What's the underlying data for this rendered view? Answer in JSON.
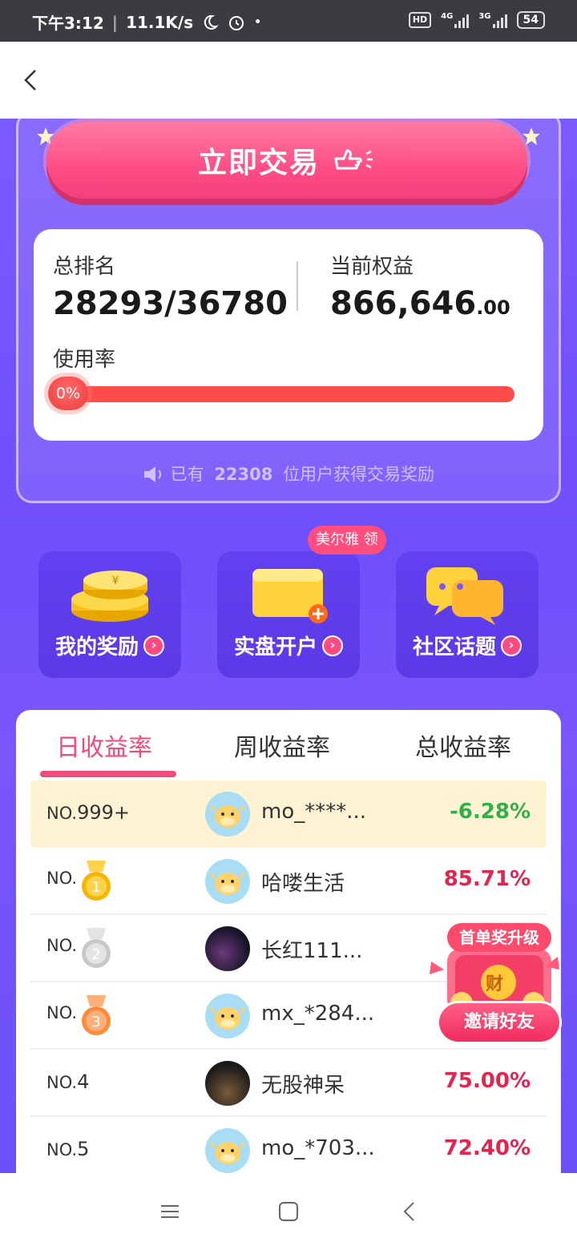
{
  "status_bar": {
    "time": "下午3:12",
    "speed": "11.1K/s",
    "hd": "HD",
    "net1": "4G",
    "net2": "3G",
    "battery": "54"
  },
  "top": {
    "trade_button": "立即交易",
    "rank_label": "总排名",
    "rank_value": "28293/36780",
    "equity_label": "当前权益",
    "equity_int": "866,646",
    "equity_dec": ".00",
    "usage_label": "使用率",
    "usage_value": "0%",
    "usage_fraction": 0,
    "announce_prefix": "已有",
    "announce_count": "22308",
    "announce_suffix": "位用户获得交易奖励"
  },
  "quick_actions": {
    "tip": "美尔雅 领",
    "items": [
      {
        "label": "我的奖励"
      },
      {
        "label": "实盘开户"
      },
      {
        "label": "社区话题"
      }
    ]
  },
  "ranking": {
    "tabs": [
      "日收益率",
      "周收益率",
      "总收益率"
    ],
    "rows": [
      {
        "no_prefix": "NO.",
        "no": "999+",
        "name": "mo_****...",
        "rate": "-6.28%"
      },
      {
        "no_prefix": "NO.",
        "no": "1",
        "name": "哈喽生活",
        "rate": "85.71%"
      },
      {
        "no_prefix": "NO.",
        "no": "2",
        "name": "长红111...",
        "rate": ""
      },
      {
        "no_prefix": "NO.",
        "no": "3",
        "name": "mx_*284...",
        "rate": ""
      },
      {
        "no_prefix": "NO.",
        "no": "4",
        "name": "无股神呆",
        "rate": "75.00%"
      },
      {
        "no_prefix": "NO.",
        "no": "5",
        "name": "mo_*703...",
        "rate": "72.40%"
      }
    ]
  },
  "float_badge": {
    "top": "首单奖升级",
    "mid": "财",
    "bottom": "邀请好友"
  },
  "colors": {
    "accent": "#f24b7a",
    "purple": "#6e4ff9",
    "positive": "#e5234f",
    "negative": "#2fb04a"
  }
}
